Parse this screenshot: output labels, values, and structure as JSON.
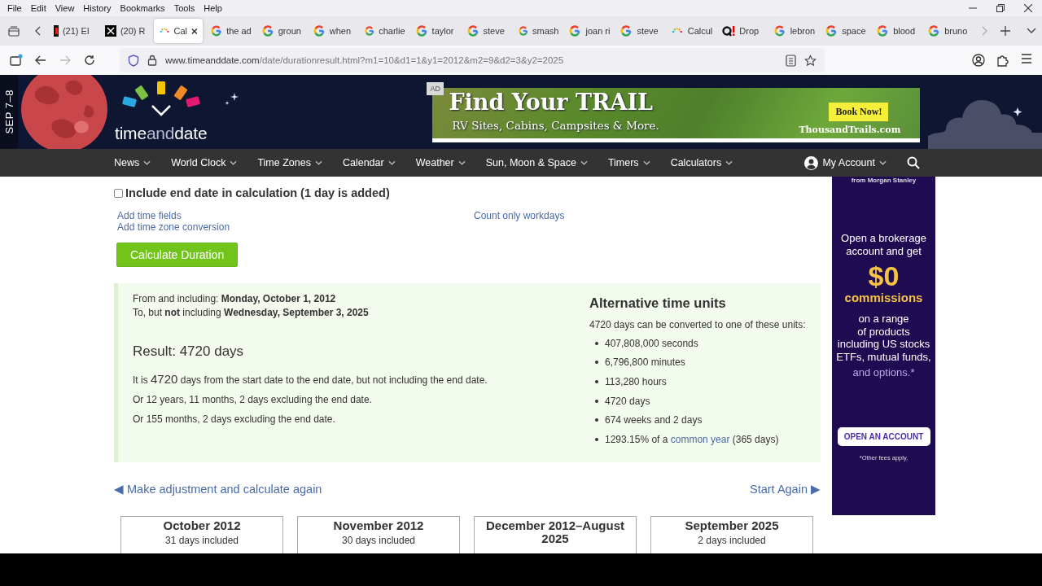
{
  "menu_bar": [
    "File",
    "Edit",
    "View",
    "History",
    "Bookmarks",
    "Tools",
    "Help"
  ],
  "tabs": [
    {
      "label": "(21) El",
      "kind": "cropped",
      "selected": false
    },
    {
      "label": "(20) R",
      "kind": "x",
      "selected": false
    },
    {
      "label": "Cal",
      "kind": "site",
      "selected": true
    },
    {
      "label": "the ad",
      "kind": "google",
      "selected": false
    },
    {
      "label": "groun",
      "kind": "google",
      "selected": false
    },
    {
      "label": "when",
      "kind": "google",
      "selected": false
    },
    {
      "label": "charlie",
      "kind": "google",
      "selected": false
    },
    {
      "label": "taylor",
      "kind": "google",
      "selected": false
    },
    {
      "label": "steve",
      "kind": "google",
      "selected": false
    },
    {
      "label": "smash",
      "kind": "google",
      "selected": false
    },
    {
      "label": "joan ri",
      "kind": "google",
      "selected": false
    },
    {
      "label": "steve",
      "kind": "google",
      "selected": false
    },
    {
      "label": "Calcul",
      "kind": "site",
      "selected": false
    },
    {
      "label": "Drop",
      "kind": "q",
      "selected": false
    },
    {
      "label": "lebron",
      "kind": "google",
      "selected": false
    },
    {
      "label": "space",
      "kind": "google",
      "selected": false
    },
    {
      "label": "blood",
      "kind": "google",
      "selected": false
    },
    {
      "label": "bruno",
      "kind": "google",
      "selected": false
    }
  ],
  "toolbar": {
    "back": {
      "disabled": false
    },
    "forward": {
      "disabled": true
    }
  },
  "address": {
    "host": "www.timeanddate.com",
    "path": "/date/durationresult.html?m1=10&d1=1&y1=2012&m2=9&d2=3&y2=2025"
  },
  "site_header": {
    "date_badge": "SEP 7–8",
    "logo": [
      "time",
      "and",
      "date"
    ],
    "ad": {
      "label": "AD",
      "headline": "Find Your TRAIL",
      "subline": "RV Sites, Cabins, Campsites & More.",
      "button": "Book Now!",
      "domain": "ThousandTrails.com"
    }
  },
  "nav": {
    "items": [
      "News",
      "World Clock",
      "Time Zones",
      "Calendar",
      "Weather",
      "Sun, Moon & Space",
      "Timers",
      "Calculators"
    ],
    "account": "My Account"
  },
  "form": {
    "include_end_date": {
      "label": "Include end date in calculation (1 day is added)",
      "checked": false
    },
    "links_left": [
      "Add time fields",
      "Add time zone conversion"
    ],
    "links_right": [
      "Count only workdays"
    ],
    "submit": "Calculate Duration"
  },
  "result": {
    "from_line": "From and including: **Monday, October 1, 2012**",
    "to_line": "To, but **not** including **Wednesday, September 3, 2025**",
    "title": "Result: 4720 days",
    "sentence": {
      "lead": "It is",
      "number": "4720",
      "rest": "days from the start date to the end date, but not including the end date."
    },
    "lines": [
      "Or 12 years, 11 months, 2 days excluding the end date.",
      "Or 155 months, 2 days excluding the end date."
    ]
  },
  "alternative": {
    "title": "Alternative time units",
    "intro": "4720 days can be converted to one of these units:",
    "items": [
      {
        "kind": "plain",
        "text": "407,808,000 seconds"
      },
      {
        "kind": "plain",
        "text": "6,796,800 minutes"
      },
      {
        "kind": "plain",
        "text": "113,280 hours"
      },
      {
        "kind": "plain",
        "text": "4720 days"
      },
      {
        "kind": "plain",
        "text": "674 weeks and 2 days"
      },
      {
        "kind": "link",
        "before": "1293.15% of a",
        "link": "common year",
        "after": "(365 days)"
      }
    ]
  },
  "bottom_links": {
    "back": "◀ Make adjustment and calculate again",
    "restart": "Start Again ▶"
  },
  "calendars": [
    {
      "title": "October 2012",
      "subtitle": "31 days included"
    },
    {
      "title": "November 2012",
      "subtitle": "30 days included"
    },
    {
      "title": "December 2012–August 2025"
    },
    {
      "title": "September 2025",
      "subtitle": "2 days included"
    }
  ],
  "side_ad": {
    "sponsor": "from Morgan Stanley",
    "lead": "Open a brokerage account and get",
    "amount": "$0",
    "amount_label": "commissions",
    "body": [
      "on a range",
      "of products",
      "including US stocks",
      "ETFs, mutual funds,"
    ],
    "tail": "and options.*",
    "button": "OPEN AN ACCOUNT",
    "footnote": "*Other fees apply."
  }
}
